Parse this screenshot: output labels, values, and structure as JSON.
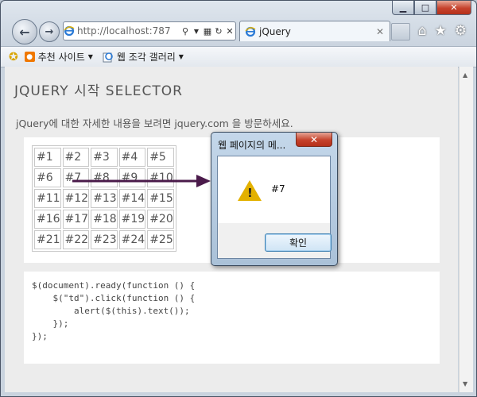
{
  "browser": {
    "address_url": "http://localhost:787",
    "tab_title": "jQuery",
    "window_controls": [
      "minimize-icon",
      "maximize-icon",
      "close-icon"
    ],
    "toolbar_icons": [
      "home-icon",
      "favorites-star-icon",
      "gear-icon"
    ]
  },
  "favorites_bar": {
    "items": [
      {
        "label": "추천 사이트"
      },
      {
        "label": "웹 조각 갤러리"
      }
    ]
  },
  "page": {
    "title": "JQUERY 시작 SELECTOR",
    "intro": "jQuery에 대한 자세한 내용을 보려면 jquery.com 을 방문하세요.",
    "grid": [
      [
        "#1",
        "#2",
        "#3",
        "#4",
        "#5"
      ],
      [
        "#6",
        "#7",
        "#8",
        "#9",
        "#10"
      ],
      [
        "#11",
        "#12",
        "#13",
        "#14",
        "#15"
      ],
      [
        "#16",
        "#17",
        "#18",
        "#19",
        "#20"
      ],
      [
        "#21",
        "#22",
        "#23",
        "#24",
        "#25"
      ]
    ],
    "code": "$(document).ready(function () {\n    $(\"td\").click(function () {\n        alert($(this).text());\n    });\n});"
  },
  "dialog": {
    "title": "웹 페이지의 메...",
    "message": "#7",
    "ok_label": "확인"
  },
  "colors": {
    "arrow": "#4a1a4a",
    "warning": "#e3b100",
    "close_red": "#c6422c"
  }
}
